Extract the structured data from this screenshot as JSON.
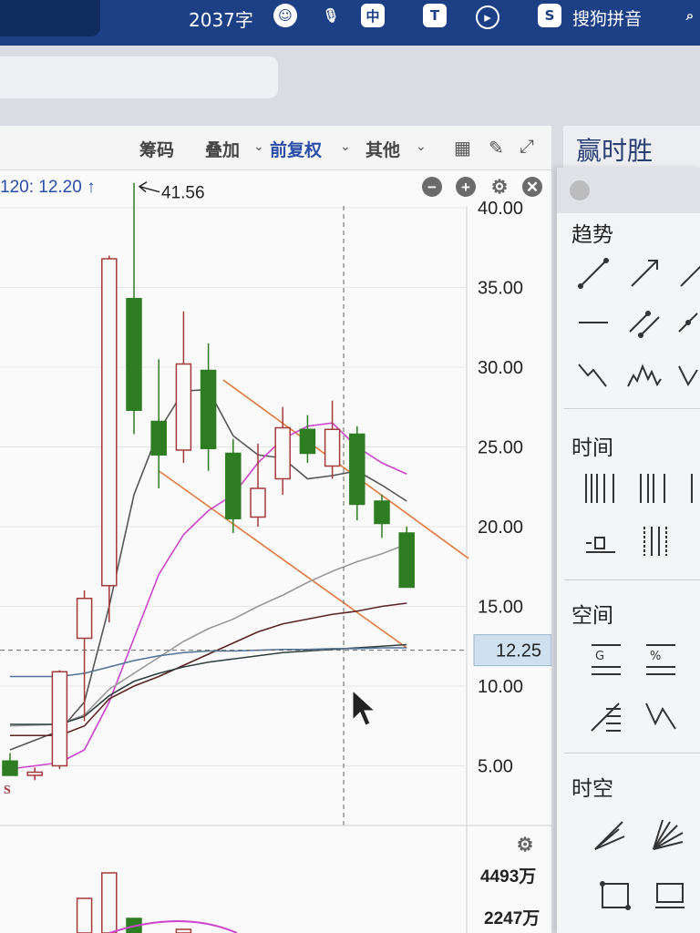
{
  "topbar": {
    "word_count": "2037字",
    "ime_chinese": "中",
    "ime_t": "T",
    "ime_brand": "S",
    "ime_name": "搜狗拼音"
  },
  "toolbar": {
    "chips": "筹码",
    "overlay": "叠加",
    "adjust": "前复权",
    "other": "其他"
  },
  "indicator": {
    "label": "120: 12.20 ↑",
    "controls": [
      "−",
      "+",
      "⚙",
      "✕"
    ]
  },
  "chart_data": {
    "type": "candlestick",
    "y_ticks": [
      "40.00",
      "35.00",
      "30.00",
      "25.00",
      "20.00",
      "15.00",
      "10.00",
      "5.00"
    ],
    "y_values": [
      40,
      35,
      30,
      25,
      20,
      15,
      10,
      5
    ],
    "crosshair_price": "12.25",
    "high_annotation": "41.56",
    "signal_marker": "S",
    "candles": [
      {
        "o": 5.3,
        "h": 5.8,
        "l": 4.4,
        "c": 4.4
      },
      {
        "o": 4.4,
        "h": 4.9,
        "l": 4.1,
        "c": 4.6
      },
      {
        "o": 5.0,
        "h": 11.0,
        "l": 4.8,
        "c": 10.9
      },
      {
        "o": 13.0,
        "h": 16.0,
        "l": 7.8,
        "c": 15.5
      },
      {
        "o": 16.3,
        "h": 37.0,
        "l": 14.0,
        "c": 36.8
      },
      {
        "o": 34.3,
        "h": 41.56,
        "l": 25.8,
        "c": 27.3
      },
      {
        "o": 26.6,
        "h": 30.5,
        "l": 22.4,
        "c": 24.5
      },
      {
        "o": 24.8,
        "h": 33.5,
        "l": 24.0,
        "c": 30.2
      },
      {
        "o": 29.8,
        "h": 31.5,
        "l": 23.5,
        "c": 24.9
      },
      {
        "o": 24.6,
        "h": 25.5,
        "l": 19.6,
        "c": 20.5
      },
      {
        "o": 20.6,
        "h": 25.2,
        "l": 20.0,
        "c": 22.4
      },
      {
        "o": 23.0,
        "h": 27.5,
        "l": 22.0,
        "c": 26.2
      },
      {
        "o": 26.1,
        "h": 27.0,
        "l": 24.0,
        "c": 24.6
      },
      {
        "o": 23.8,
        "h": 27.9,
        "l": 23.0,
        "c": 26.1
      },
      {
        "o": 25.8,
        "h": 26.3,
        "l": 20.4,
        "c": 21.4
      },
      {
        "o": 21.6,
        "h": 22.0,
        "l": 19.3,
        "c": 20.2
      },
      {
        "o": 19.6,
        "h": 20.0,
        "l": 16.2,
        "c": 16.2
      }
    ],
    "moving_averages": [
      {
        "color": "#555555",
        "values": [
          [
            0,
            6.0
          ],
          [
            2,
            7.2
          ],
          [
            3,
            9.0
          ],
          [
            4,
            15.0
          ],
          [
            5,
            22.0
          ],
          [
            6,
            26.0
          ],
          [
            7,
            28.5
          ],
          [
            8,
            28.6
          ],
          [
            9,
            25.7
          ],
          [
            10,
            24.5
          ],
          [
            11,
            24.3
          ],
          [
            12,
            23.0
          ],
          [
            13,
            23.2
          ],
          [
            14,
            23.5
          ],
          [
            15,
            22.6
          ],
          [
            16,
            21.6
          ]
        ]
      },
      {
        "color": "#cc44cc",
        "values": [
          [
            0,
            4.8
          ],
          [
            2,
            5.2
          ],
          [
            3,
            6.0
          ],
          [
            4,
            9.0
          ],
          [
            5,
            13.0
          ],
          [
            6,
            17.0
          ],
          [
            7,
            19.5
          ],
          [
            8,
            21.0
          ],
          [
            9,
            22.0
          ],
          [
            10,
            24.0
          ],
          [
            11,
            25.5
          ],
          [
            12,
            26.3
          ],
          [
            13,
            26.5
          ],
          [
            14,
            25.0
          ],
          [
            15,
            24.0
          ],
          [
            16,
            23.3
          ]
        ]
      },
      {
        "color": "#999999",
        "values": [
          [
            0,
            7.5
          ],
          [
            2,
            7.6
          ],
          [
            3,
            8.2
          ],
          [
            4,
            9.8
          ],
          [
            5,
            10.8
          ],
          [
            6,
            11.8
          ],
          [
            7,
            12.8
          ],
          [
            8,
            13.6
          ],
          [
            9,
            14.2
          ],
          [
            10,
            15.0
          ],
          [
            11,
            15.7
          ],
          [
            12,
            16.5
          ],
          [
            13,
            17.2
          ],
          [
            14,
            17.8
          ],
          [
            15,
            18.3
          ],
          [
            16,
            18.9
          ]
        ]
      },
      {
        "color": "#5a2424",
        "values": [
          [
            0,
            6.9
          ],
          [
            2,
            6.9
          ],
          [
            3,
            7.5
          ],
          [
            4,
            9.2
          ],
          [
            5,
            10.0
          ],
          [
            6,
            10.6
          ],
          [
            7,
            11.3
          ],
          [
            8,
            12.0
          ],
          [
            9,
            12.7
          ],
          [
            10,
            13.4
          ],
          [
            11,
            13.9
          ],
          [
            12,
            14.2
          ],
          [
            13,
            14.5
          ],
          [
            14,
            14.7
          ],
          [
            15,
            15.0
          ],
          [
            16,
            15.2
          ]
        ]
      },
      {
        "color": "#2f3f3f",
        "values": [
          [
            0,
            7.6
          ],
          [
            2,
            7.6
          ],
          [
            3,
            8.1
          ],
          [
            4,
            9.4
          ],
          [
            5,
            10.3
          ],
          [
            6,
            10.8
          ],
          [
            7,
            11.2
          ],
          [
            8,
            11.5
          ],
          [
            9,
            11.7
          ],
          [
            10,
            11.9
          ],
          [
            11,
            12.1
          ],
          [
            12,
            12.2
          ],
          [
            13,
            12.3
          ],
          [
            14,
            12.4
          ],
          [
            15,
            12.5
          ],
          [
            16,
            12.6
          ]
        ]
      },
      {
        "color": "#4f7296",
        "values": [
          [
            0,
            10.6
          ],
          [
            2,
            10.6
          ],
          [
            3,
            10.8
          ],
          [
            4,
            11.2
          ],
          [
            5,
            11.6
          ],
          [
            6,
            11.9
          ],
          [
            7,
            12.1
          ],
          [
            8,
            12.2
          ],
          [
            9,
            12.2
          ],
          [
            10,
            12.25
          ],
          [
            11,
            12.3
          ],
          [
            12,
            12.3
          ],
          [
            13,
            12.35
          ],
          [
            14,
            12.35
          ],
          [
            15,
            12.4
          ],
          [
            16,
            12.4
          ]
        ]
      }
    ],
    "trend_lines": [
      {
        "color": "#e07a3c",
        "from": [
          8.6,
          29.2
        ],
        "to": [
          18.5,
          18.0
        ]
      },
      {
        "color": "#e07a3c",
        "from": [
          6.0,
          23.5
        ],
        "to": [
          16.0,
          12.4
        ]
      }
    ]
  },
  "volume": {
    "labels": [
      "4493万",
      "2247万"
    ]
  },
  "right_panel": {
    "title": "赢时胜",
    "sections": [
      "趋势",
      "时间",
      "空间",
      "时空"
    ]
  }
}
